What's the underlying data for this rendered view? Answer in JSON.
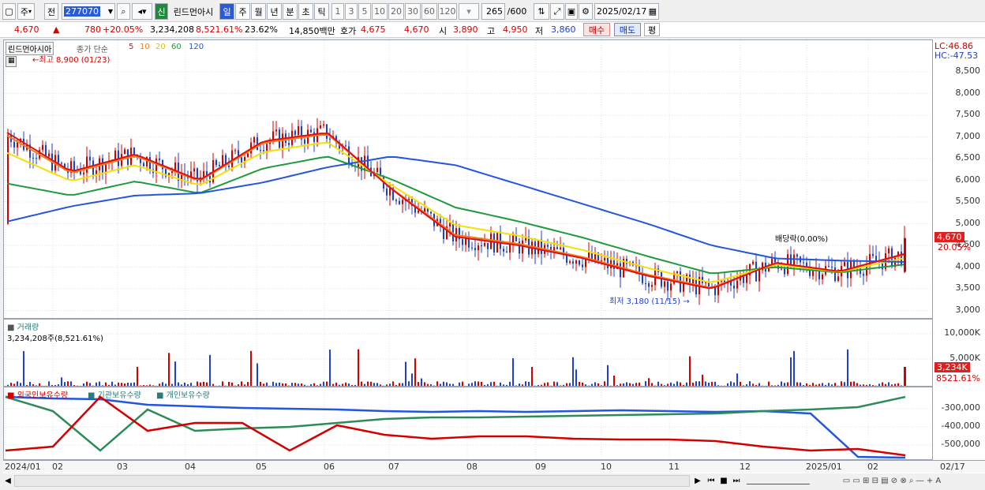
{
  "toolbar": {
    "type_select": "주",
    "prev_label": "전",
    "code": "277070",
    "sin_label": "신",
    "name": "린드먼아시",
    "periods": [
      "일",
      "주",
      "월",
      "년",
      "분",
      "초",
      "틱"
    ],
    "minutes": [
      "1",
      "3",
      "5",
      "10",
      "20",
      "30",
      "60",
      "120"
    ],
    "count": "265",
    "count_total": "/600",
    "date": "2025/02/17"
  },
  "infobar": {
    "price": "4,670",
    "change": "780",
    "change_pct": "+20.05%",
    "volume": "3,234,208",
    "volume_pct": "8,521.61%",
    "turnover": "23.62%",
    "amount": "14,850백만",
    "quote_label": "호가",
    "ask": "4,675",
    "bid": "4,670",
    "open_label": "시",
    "open": "3,890",
    "high_label": "고",
    "high": "4,950",
    "low_label": "저",
    "low": "3,860",
    "buy_label": "매수",
    "sell_label": "매도",
    "eval_label": "평"
  },
  "price_pane": {
    "legend_name": "린드먼아시아",
    "legend_type": "종가 단순",
    "ma_periods": [
      "5",
      "10",
      "20",
      "60",
      "120"
    ],
    "high_note": "최고 8,900 (01/23)",
    "low_note": "최저 3,180 (11/15)",
    "dividend_note": "배당락(0.00%)",
    "lc": "LC:46.86",
    "hc": "HC:-47.53",
    "last_price": "4,670",
    "last_pct": "20.05%",
    "y_ticks": [
      "8,500",
      "8,000",
      "7,500",
      "7,000",
      "6,500",
      "6,000",
      "5,500",
      "5,000",
      "4,500",
      "4,000",
      "3,500",
      "3,000"
    ]
  },
  "volume_pane": {
    "title": "거래량",
    "value": "3,234,208주(8,521.61%)",
    "y_ticks": [
      "10,000K",
      "5,000K"
    ],
    "last_value": "3,234K",
    "last_pct": "8521.61%"
  },
  "holding_pane": {
    "legends": [
      "외국인보유수량",
      "기관보유수량",
      "개인보유수량"
    ],
    "y_ticks": [
      "-300,000",
      "-400,000",
      "-500,000"
    ]
  },
  "x_axis": {
    "labels": [
      "2024/01",
      "02",
      "03",
      "04",
      "05",
      "06",
      "07",
      "08",
      "09",
      "10",
      "11",
      "12",
      "2025/01",
      "02"
    ],
    "right_date": "02/17"
  },
  "colors": {
    "up": "#d40000",
    "down": "#1f3fd0",
    "ma5": "#e01010",
    "ma10": "#f07e1a",
    "ma20": "#f5e100",
    "ma60": "#1f9a3c",
    "ma120": "#2255e0",
    "foreign": "#2255e0",
    "institution": "#2e8b57",
    "individual": "#d40000"
  },
  "chart_data": {
    "type": "line",
    "title": "린드먼아시아",
    "x": [
      "2024/01",
      "02",
      "03",
      "04",
      "05",
      "06",
      "07",
      "08",
      "09",
      "10",
      "11",
      "12",
      "2025/01",
      "02",
      "02/17"
    ],
    "series": [
      {
        "name": "5",
        "values": [
          7100,
          6200,
          6600,
          6000,
          6900,
          7100,
          5800,
          4700,
          4500,
          4200,
          3800,
          3500,
          4100,
          3900,
          4300
        ]
      },
      {
        "name": "120",
        "values": [
          5050,
          5400,
          5650,
          5700,
          5950,
          6300,
          6550,
          6350,
          5900,
          5450,
          5000,
          4500,
          4200,
          4150,
          4120
        ]
      }
    ],
    "ylim": [
      2900,
      8900
    ],
    "high": {
      "value": 8900,
      "date": "01/23"
    },
    "low": {
      "value": 3180,
      "date": "11/15"
    },
    "last": 4670
  }
}
